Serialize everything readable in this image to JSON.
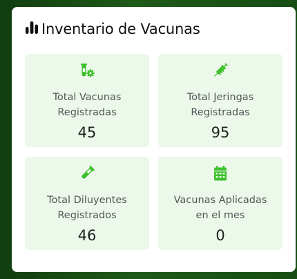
{
  "card": {
    "title": "Inventario de Vacunas",
    "icon": "bar-chart-icon"
  },
  "stats": [
    {
      "label_line1": "Total Vacunas",
      "label_line2": "Registradas",
      "value": "45",
      "icon": "vaccine-vial-gear-icon"
    },
    {
      "label_line1": "Total Jeringas",
      "label_line2": "Registradas",
      "value": "95",
      "icon": "syringe-icon"
    },
    {
      "label_line1": "Total Diluyentes",
      "label_line2": "Registrados",
      "value": "46",
      "icon": "test-tube-icon"
    },
    {
      "label_line1": "Vacunas Aplicadas",
      "label_line2": "en el mes",
      "value": "0",
      "icon": "calendar-icon"
    }
  ],
  "colors": {
    "accent": "#3ec02c",
    "tile_bg": "#ebf8ea",
    "page_bg": "#1a4f16"
  }
}
